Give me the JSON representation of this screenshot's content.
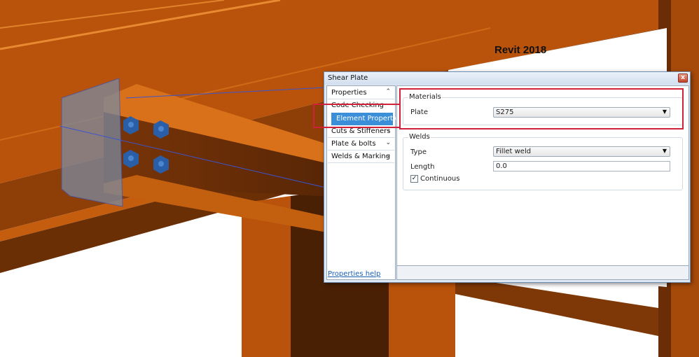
{
  "caption": "Revit 2018",
  "dialog": {
    "title": "Shear Plate",
    "close_symbol": "x",
    "nav": [
      {
        "label": "Properties",
        "chevron": "⌃"
      },
      {
        "label": "Code Checking",
        "chevron": ""
      },
      {
        "label": "Element Properties",
        "chevron": ""
      },
      {
        "label": "Cuts & Stiffeners",
        "chevron": "⌄"
      },
      {
        "label": "Plate & bolts",
        "chevron": "⌄"
      },
      {
        "label": "Welds & Marking",
        "chevron": "⌄"
      }
    ],
    "help_link": "Properties help",
    "materials": {
      "title": "Materials",
      "plate_label": "Plate",
      "plate_value": "S275"
    },
    "welds": {
      "title": "Welds",
      "type_label": "Type",
      "type_value": "Fillet weld",
      "length_label": "Length",
      "length_value": "0.0",
      "continuous_label": "Continuous",
      "continuous_checked": true
    }
  },
  "colors": {
    "steel": "#b8520a",
    "steel_light": "#d56a15",
    "steel_dark": "#5a2606",
    "bolt": "#2a5fa8",
    "highlight": "#d0203a",
    "selection": "#3b8fd9"
  }
}
